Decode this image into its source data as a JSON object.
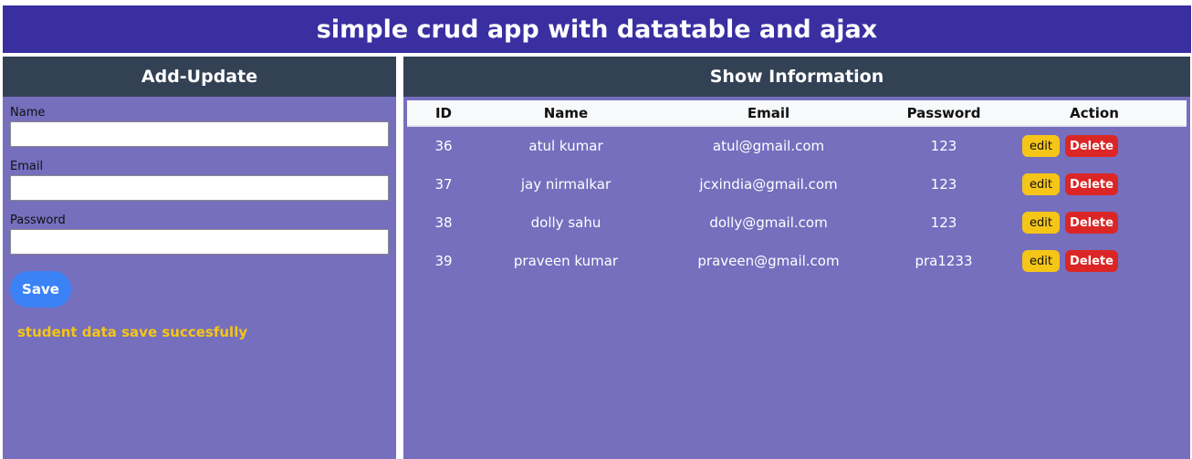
{
  "app": {
    "title": "simple crud app with datatable and ajax"
  },
  "form": {
    "heading": "Add-Update",
    "fields": [
      {
        "label": "Name",
        "value": "",
        "placeholder": ""
      },
      {
        "label": "Email",
        "value": "",
        "placeholder": ""
      },
      {
        "label": "Password",
        "value": "",
        "placeholder": ""
      }
    ],
    "save_label": "Save",
    "status_message": "student data save succesfully"
  },
  "table": {
    "heading": "Show Information",
    "columns": [
      "ID",
      "Name",
      "Email",
      "Password",
      "Action"
    ],
    "rows": [
      {
        "id": "36",
        "name": "atul kumar",
        "email": "atul@gmail.com",
        "password": "123"
      },
      {
        "id": "37",
        "name": "jay nirmalkar",
        "email": "jcxindia@gmail.com",
        "password": "123"
      },
      {
        "id": "38",
        "name": "dolly sahu",
        "email": "dolly@gmail.com",
        "password": "123"
      },
      {
        "id": "39",
        "name": "praveen kumar",
        "email": "praveen@gmail.com",
        "password": "pra1233"
      }
    ],
    "edit_label": "edit",
    "delete_label": "Delete"
  },
  "colors": {
    "header_bg": "#3a2fa1",
    "panel_bg": "#756fbe",
    "panel_head_bg": "#334155",
    "save_button": "#3b82f6",
    "edit_button": "#f5c518",
    "delete_button": "#dc2626",
    "status_text": "#f5c518"
  }
}
